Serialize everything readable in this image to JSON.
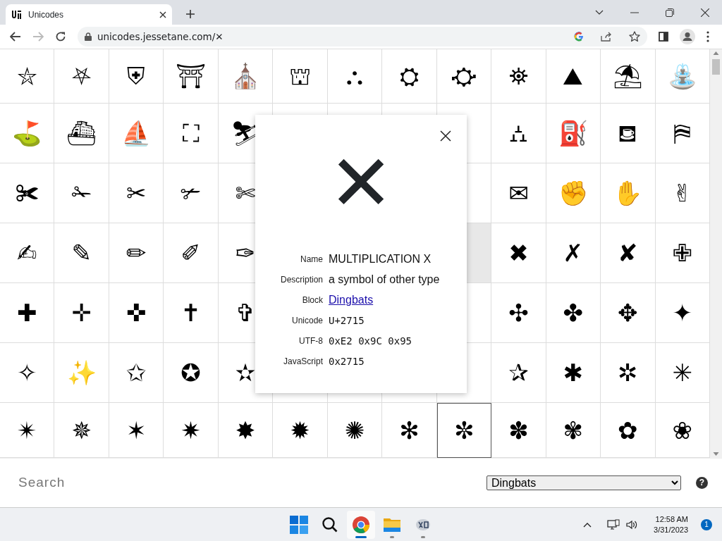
{
  "browser": {
    "tab": {
      "title": "Unicodes"
    },
    "address": "unicodes.jessetane.com/✕",
    "forward_disabled": true
  },
  "grid": {
    "rows": [
      {
        "cells": [
          {
            "glyph": "⛦",
            "selected": false,
            "hovered": false
          },
          {
            "glyph": "⛧",
            "selected": false,
            "hovered": false
          },
          {
            "glyph": "⛨",
            "selected": false,
            "hovered": false
          },
          {
            "glyph": "⛩",
            "selected": false,
            "hovered": false
          },
          {
            "glyph": "⛪",
            "selected": false,
            "hovered": false
          },
          {
            "glyph": "⛫",
            "selected": false,
            "hovered": false
          },
          {
            "glyph": "⛬",
            "selected": false,
            "hovered": false
          },
          {
            "glyph": "⛭",
            "selected": false,
            "hovered": false
          },
          {
            "glyph": "⛮",
            "selected": false,
            "hovered": false
          },
          {
            "glyph": "⛯",
            "selected": false,
            "hovered": false
          },
          {
            "glyph": "⛰",
            "selected": false,
            "hovered": false
          },
          {
            "glyph": "⛱",
            "selected": false,
            "hovered": false
          },
          {
            "glyph": "⛲",
            "selected": false,
            "hovered": false
          }
        ]
      },
      {
        "cells": [
          {
            "glyph": "⛳",
            "selected": false,
            "hovered": false
          },
          {
            "glyph": "⛴",
            "selected": false,
            "hovered": false
          },
          {
            "glyph": "⛵",
            "selected": false,
            "hovered": false
          },
          {
            "glyph": "⛶",
            "selected": false,
            "hovered": false
          },
          {
            "glyph": "⛷",
            "selected": false,
            "hovered": false
          },
          {
            "selected": false,
            "hovered": false
          },
          {
            "selected": false,
            "hovered": false
          },
          {
            "selected": false,
            "hovered": false
          },
          {
            "selected": false,
            "hovered": false
          },
          {
            "glyph": "⛼",
            "selected": false,
            "hovered": false
          },
          {
            "glyph": "⛽",
            "selected": false,
            "hovered": false
          },
          {
            "glyph": "⛾",
            "selected": false,
            "hovered": false
          },
          {
            "glyph": "⛿",
            "selected": false,
            "hovered": false
          }
        ]
      },
      {
        "cells": [
          {
            "glyph": "✀",
            "selected": false,
            "hovered": false
          },
          {
            "glyph": "✁",
            "selected": false,
            "hovered": false
          },
          {
            "glyph": "✂",
            "selected": false,
            "hovered": false
          },
          {
            "glyph": "✃",
            "selected": false,
            "hovered": false
          },
          {
            "glyph": "✄",
            "selected": false,
            "hovered": false
          }
        ],
        "cells_after_popup": [
          {
            "selected": false,
            "hovered": false
          },
          {
            "glyph": "✉",
            "selected": false,
            "hovered": false
          },
          {
            "glyph": "✊",
            "selected": false,
            "hovered": false
          },
          {
            "glyph": "✋",
            "selected": false,
            "hovered": false
          },
          {
            "glyph": "✌",
            "selected": false,
            "hovered": false
          }
        ]
      },
      {
        "cells": [
          {
            "glyph": "✍",
            "selected": false,
            "hovered": false
          },
          {
            "glyph": "✎",
            "selected": false,
            "hovered": false
          },
          {
            "glyph": "✏",
            "selected": false,
            "hovered": false
          },
          {
            "glyph": "✐",
            "selected": false,
            "hovered": false
          },
          {
            "glyph": "✑",
            "selected": false,
            "hovered": false
          }
        ],
        "cells_after_popup": [
          {
            "selected": true,
            "hovered": false
          },
          {
            "glyph": "✖",
            "selected": false,
            "hovered": false
          },
          {
            "glyph": "✗",
            "selected": false,
            "hovered": false
          },
          {
            "glyph": "✘",
            "selected": false,
            "hovered": false
          },
          {
            "glyph": "✙",
            "selected": false,
            "hovered": false
          }
        ]
      },
      {
        "cells": [
          {
            "glyph": "✚",
            "selected": false,
            "hovered": false
          },
          {
            "glyph": "✛",
            "selected": false,
            "hovered": false
          },
          {
            "glyph": "✜",
            "selected": false,
            "hovered": false
          },
          {
            "glyph": "✝",
            "selected": false,
            "hovered": false
          },
          {
            "glyph": "✞",
            "selected": false,
            "hovered": false
          }
        ],
        "cells_after_popup": [
          {
            "selected": false,
            "hovered": false
          },
          {
            "glyph": "✣",
            "selected": false,
            "hovered": false
          },
          {
            "glyph": "✤",
            "selected": false,
            "hovered": false
          },
          {
            "glyph": "✥",
            "selected": false,
            "hovered": false
          },
          {
            "glyph": "✦",
            "selected": false,
            "hovered": false
          }
        ]
      },
      {
        "cells": [
          {
            "glyph": "✧",
            "selected": false,
            "hovered": false
          },
          {
            "glyph": "✨",
            "selected": false,
            "hovered": false
          },
          {
            "glyph": "✩",
            "selected": false,
            "hovered": false
          },
          {
            "glyph": "✪",
            "selected": false,
            "hovered": false
          },
          {
            "glyph": "✫",
            "selected": false,
            "hovered": false
          },
          {
            "selected": false,
            "hovered": false
          },
          {
            "selected": false,
            "hovered": false
          },
          {
            "selected": false,
            "hovered": false
          },
          {
            "selected": false,
            "hovered": false
          },
          {
            "glyph": "✰",
            "selected": false,
            "hovered": false
          },
          {
            "glyph": "✱",
            "selected": false,
            "hovered": false
          },
          {
            "glyph": "✲",
            "selected": false,
            "hovered": false
          },
          {
            "glyph": "✳",
            "selected": false,
            "hovered": false
          }
        ]
      },
      {
        "cells": [
          {
            "glyph": "✴",
            "selected": false,
            "hovered": false
          },
          {
            "glyph": "✵",
            "selected": false,
            "hovered": false
          },
          {
            "glyph": "✶",
            "selected": false,
            "hovered": false
          },
          {
            "glyph": "✷",
            "selected": false,
            "hovered": false
          },
          {
            "glyph": "✸",
            "selected": false,
            "hovered": false
          },
          {
            "glyph": "✹",
            "selected": false,
            "hovered": false
          },
          {
            "glyph": "✺",
            "selected": false,
            "hovered": false
          },
          {
            "glyph": "✻",
            "selected": false,
            "hovered": false
          },
          {
            "glyph": "✼",
            "selected": false,
            "hovered": true
          },
          {
            "glyph": "✽",
            "selected": false,
            "hovered": false
          },
          {
            "glyph": "✾",
            "selected": false,
            "hovered": false
          },
          {
            "glyph": "✿",
            "selected": false,
            "hovered": false
          },
          {
            "glyph": "❀",
            "selected": false,
            "hovered": false
          }
        ]
      }
    ]
  },
  "detail": {
    "glyph": "✕",
    "fields": [
      {
        "label": "Name",
        "value": "MULTIPLICATION X",
        "kind": "text"
      },
      {
        "label": "Description",
        "value": "a symbol of other type",
        "kind": "text"
      },
      {
        "label": "Block",
        "value": "Dingbats",
        "kind": "link"
      },
      {
        "label": "Unicode",
        "value": "U+2715",
        "kind": "code"
      },
      {
        "label": "UTF-8",
        "value": "0xE2 0x9C 0x95",
        "kind": "code"
      },
      {
        "label": "JavaScript",
        "value": "0x2715",
        "kind": "code"
      }
    ]
  },
  "search": {
    "placeholder": "Search"
  },
  "block_select": {
    "value": "Dingbats"
  },
  "help": "?",
  "taskbar": {
    "apps": [
      {
        "kind": "start",
        "running": false,
        "active": false
      },
      {
        "kind": "search",
        "running": false,
        "active": false
      },
      {
        "kind": "browser",
        "running": true,
        "active": true
      },
      {
        "kind": "folder",
        "running": true,
        "active": false
      },
      {
        "kind": "app",
        "running": true,
        "active": false
      }
    ],
    "time": "12:58 AM",
    "date": "3/31/2023",
    "notifications": "1"
  }
}
